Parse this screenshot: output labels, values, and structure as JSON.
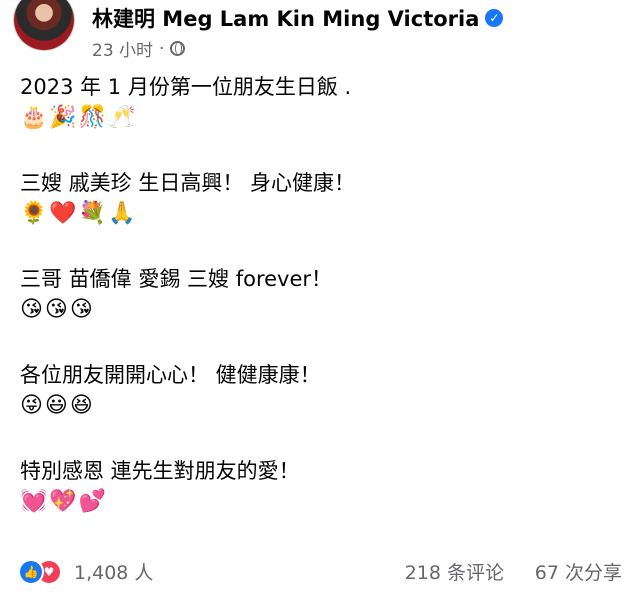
{
  "header": {
    "author": "林建明 Meg Lam Kin Ming Victoria",
    "verified_icon": "verified-badge-icon",
    "timestamp": "23 小时",
    "separator": "·",
    "audience_icon": "globe-icon"
  },
  "post": {
    "lines": [
      {
        "text": "2023 年 1 月份第一位朋友生日飯 .",
        "emojis": "🎂🎉🎊🥂"
      },
      {
        "text": "三嫂 戚美珍 生日高興！ 身心健康！",
        "emojis": "🌻❤️💐🙏"
      },
      {
        "text": "三哥 苗僑偉 愛錫 三嫂 forever！",
        "emojis": "😘😘😘"
      },
      {
        "text": "各位朋友開開心心！ 健健康康！",
        "emojis": "😜😃😆"
      },
      {
        "text": "特別感恩 連先生對朋友的愛！",
        "emojis": "💓💖💕"
      }
    ]
  },
  "footer": {
    "reaction_icons": [
      "like-icon",
      "love-icon"
    ],
    "reaction_count": "1,408 人",
    "comments": "218 条评论",
    "shares": "67 次分享"
  },
  "colors": {
    "accent": "#1877f2",
    "love": "#f33e58",
    "muted": "#65676b"
  }
}
